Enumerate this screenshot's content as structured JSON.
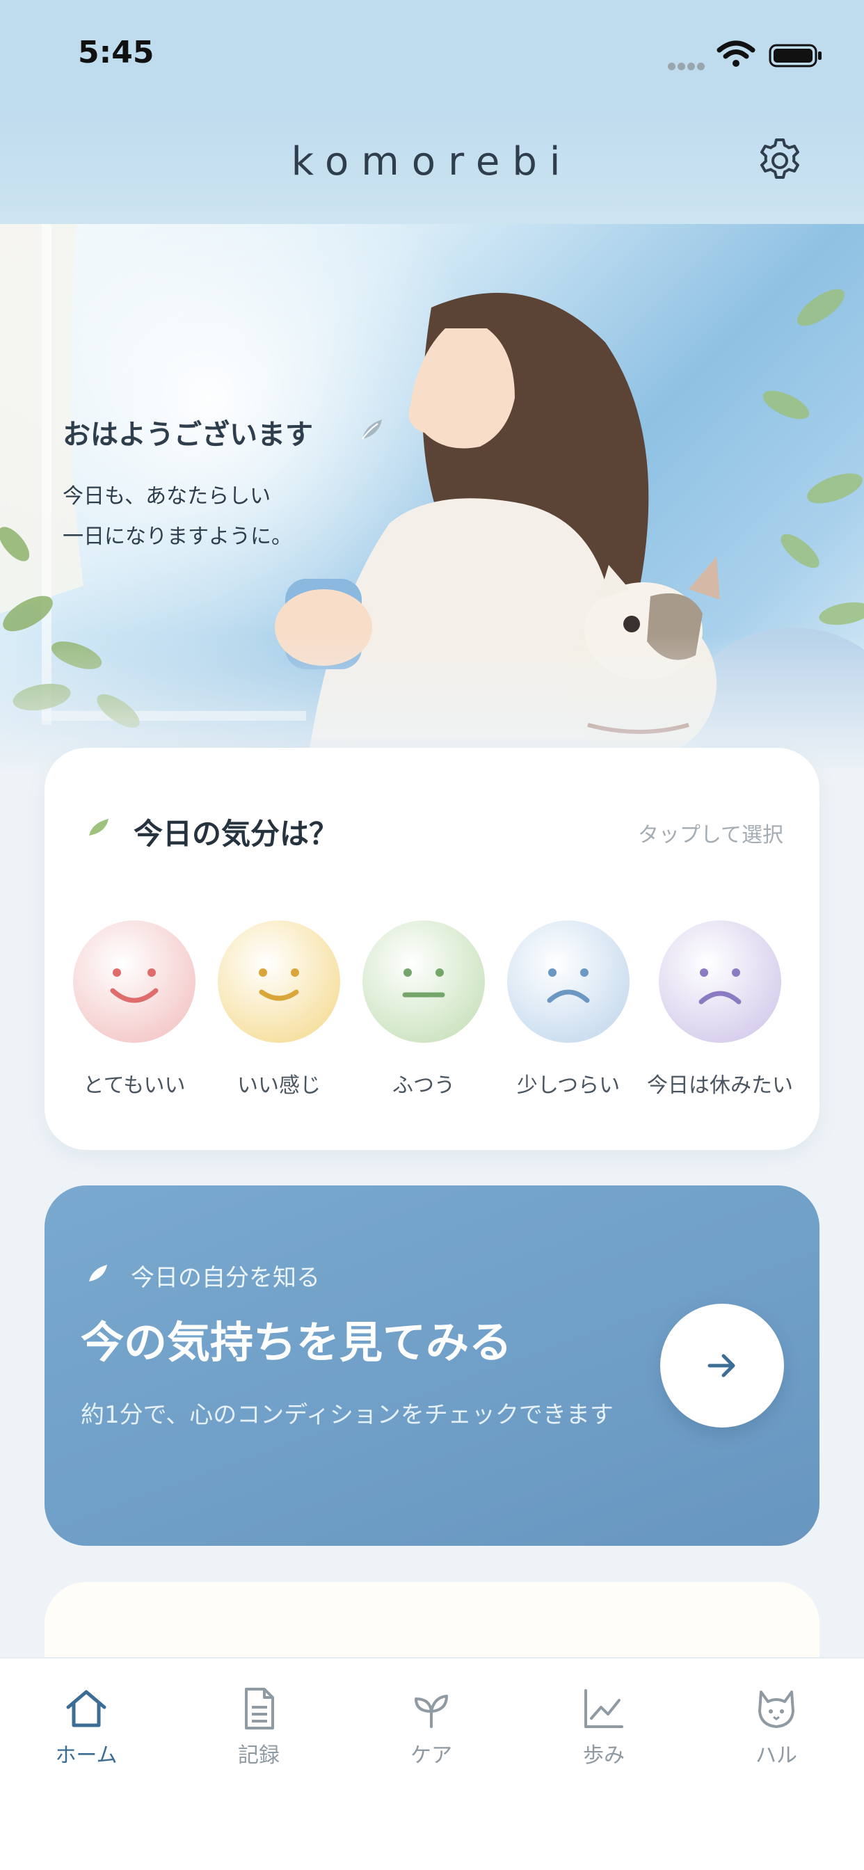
{
  "status_bar": {
    "time": "5:45"
  },
  "header": {
    "title": "komorebi"
  },
  "hero": {
    "greeting": "おはようございます",
    "message_line1": "今日も、あなたらしい",
    "message_line2": "一日になりますように。"
  },
  "mood": {
    "title": "今日の気分は？",
    "hint": "タップして選択",
    "options": [
      {
        "label": "とてもいい",
        "color": "#f6d3d3",
        "feature": "#e06b6b"
      },
      {
        "label": "いい感じ",
        "color": "#f9e6b4",
        "feature": "#d9a63a"
      },
      {
        "label": "ふつう",
        "color": "#d8ebcf",
        "feature": "#74a66a"
      },
      {
        "label": "少しつらい",
        "color": "#d9e8f5",
        "feature": "#6a98c3"
      },
      {
        "label": "今日は休みたい",
        "color": "#e2dbf1",
        "feature": "#8b7bc2"
      }
    ]
  },
  "check": {
    "eyebrow": "今日の自分を知る",
    "title": "今の気持ちを見てみる",
    "description": "約1分で、心のコンディションをチェックできます"
  },
  "tabs": [
    {
      "label": "ホーム",
      "icon": "home-icon",
      "active": true
    },
    {
      "label": "記録",
      "icon": "document-icon",
      "active": false
    },
    {
      "label": "ケア",
      "icon": "sprout-icon",
      "active": false
    },
    {
      "label": "歩み",
      "icon": "chart-icon",
      "active": false
    },
    {
      "label": "ハル",
      "icon": "cat-icon",
      "active": false
    }
  ],
  "colors": {
    "accent": "#3c6d95",
    "card_blue": "#6f9ec7",
    "header_blue": "#bfdcee"
  }
}
